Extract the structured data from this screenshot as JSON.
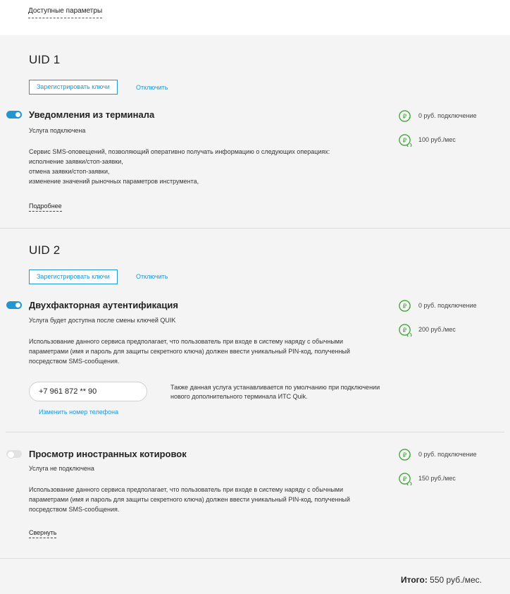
{
  "top": {
    "tab_label": "Доступные параметры"
  },
  "uid1": {
    "title": "UID 1",
    "register_btn": "Зарегистрировать ключи",
    "disable_link": "Отключить",
    "service": {
      "title": "Уведомления из терминала",
      "enabled": true,
      "status": "Услуга подключена",
      "desc_lines": [
        "Сервис SMS-оповещений, позволяющий оперативно получать информацию о следующих операциях:",
        "исполнение заявки/стоп-заявки,",
        "отмена заявки/стоп-заявки,",
        "изменение значений рыночных параметров инструмента,"
      ],
      "more_link": "Подробнее",
      "price_connect": "0 руб. подключение",
      "price_monthly": "100 руб./мес"
    }
  },
  "uid2": {
    "title": "UID 2",
    "register_btn": "Зарегистрировать ключи",
    "disable_link": "Отключить",
    "service1": {
      "title": "Двухфакторная аутентификация",
      "enabled": true,
      "status": "Услуга будет доступна после смены ключей QUIK",
      "desc_lines": [
        "Использование данного сервиса предполагает, что пользователь при входе в систему наряду с обычными",
        "параметрами (имя и пароль для защиты секретного ключа) должен ввести уникальный PIN-код, полученный",
        "посредством SMS-сообщения."
      ],
      "phone": "+7 961 872 ** 90",
      "change_phone_link": "Изменить номер телефона",
      "note_lines": [
        "Также данная услуга устанавливается по умолчанию при подключении",
        "нового дополнительного терминала ИТС Quik."
      ],
      "price_connect": "0 руб. подключение",
      "price_monthly": "200 руб./мес"
    },
    "service2": {
      "title": "Просмотр иностранных котировок",
      "enabled": false,
      "status": "Услуга не подключена",
      "desc_lines": [
        "Использование данного сервиса предполагает, что пользователь при входе в систему наряду с обычными",
        "параметрами (имя и пароль для защиты секретного ключа) должен ввести уникальный PIN-код, полученный",
        "посредством SMS-сообщения."
      ],
      "collapse_link": "Свернуть",
      "price_connect": "0 руб. подключение",
      "price_monthly": "150 руб./мес"
    }
  },
  "total": {
    "label": "Итого:",
    "value": "550 руб./мес."
  },
  "colors": {
    "accent": "#2196d3",
    "icon_green": "#3fa535"
  }
}
